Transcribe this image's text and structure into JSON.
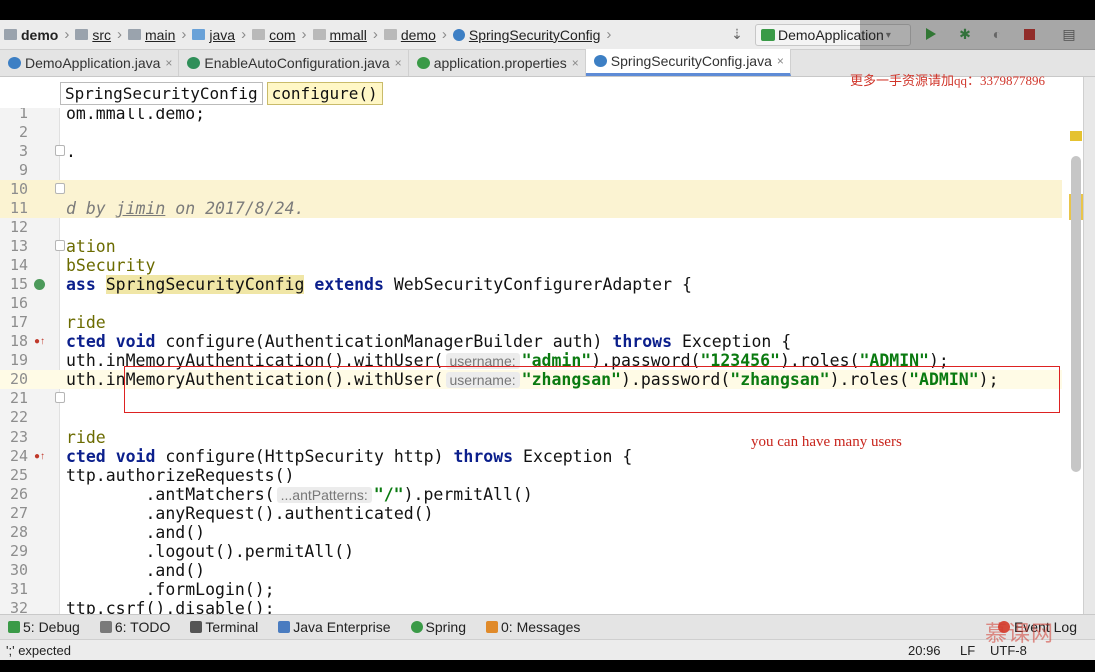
{
  "breadcrumb": [
    {
      "label": "demo",
      "icon": "project-folder-icon"
    },
    {
      "label": "src",
      "icon": "folder-icon"
    },
    {
      "label": "main",
      "icon": "folder-icon"
    },
    {
      "label": "java",
      "icon": "source-folder-icon"
    },
    {
      "label": "com",
      "icon": "package-icon"
    },
    {
      "label": "mmall",
      "icon": "package-icon"
    },
    {
      "label": "demo",
      "icon": "package-icon"
    },
    {
      "label": "SpringSecurityConfig",
      "icon": "class-icon"
    }
  ],
  "run_config": {
    "label": "DemoApplication"
  },
  "tabs": [
    {
      "label": "DemoApplication.java",
      "icon_color": "#3d7fc4",
      "active": false
    },
    {
      "label": "EnableAutoConfiguration.java",
      "icon_color": "#2f8f59",
      "active": false
    },
    {
      "label": "application.properties",
      "icon_color": "#3a9a47",
      "active": false
    },
    {
      "label": "SpringSecurityConfig.java",
      "icon_color": "#3d7fc4",
      "active": true
    }
  ],
  "method_path": {
    "class_name": "SpringSecurityConfig",
    "method_name": "configure()"
  },
  "editor": {
    "lines": [
      {
        "n": "1",
        "text": "om.mmall.demo;"
      },
      {
        "n": "2",
        "text": ""
      },
      {
        "n": "3",
        "text": "."
      },
      {
        "n": "9",
        "text": ""
      },
      {
        "n": "10",
        "text": ""
      },
      {
        "n": "11",
        "text": "d by jimin on 2017/8/24."
      },
      {
        "n": "12",
        "text": ""
      },
      {
        "n": "13",
        "text": "ation"
      },
      {
        "n": "14",
        "text": "bSecurity"
      },
      {
        "n": "15",
        "text": "ass SpringSecurityConfig extends WebSecurityConfigurerAdapter {"
      },
      {
        "n": "16",
        "text": ""
      },
      {
        "n": "17",
        "text": "ride"
      },
      {
        "n": "18",
        "text": "cted void configure(AuthenticationManagerBuilder auth) throws Exception {"
      },
      {
        "n": "19",
        "text": "uth.inMemoryAuthentication().withUser( username: \"admin\").password(\"123456\").roles(\"ADMIN\");"
      },
      {
        "n": "20",
        "text": "uth.inMemoryAuthentication().withUser( username: \"zhangsan\").password(\"zhangsan\").roles(\"ADMIN\");"
      },
      {
        "n": "21",
        "text": ""
      },
      {
        "n": "22",
        "text": ""
      },
      {
        "n": "23",
        "text": "ride"
      },
      {
        "n": "24",
        "text": "cted void configure(HttpSecurity http) throws Exception {"
      },
      {
        "n": "25",
        "text": "ttp.authorizeRequests()"
      },
      {
        "n": "26",
        "text": "        .antMatchers( ...antPatterns: \"/\").permitAll()"
      },
      {
        "n": "27",
        "text": "        .anyRequest().authenticated()"
      },
      {
        "n": "28",
        "text": "        .and()"
      },
      {
        "n": "29",
        "text": "        .logout().permitAll()"
      },
      {
        "n": "30",
        "text": "        .and()"
      },
      {
        "n": "31",
        "text": "        .formLogin();"
      },
      {
        "n": "32",
        "text": "ttp.csrf().disable();"
      }
    ],
    "tokens": {
      "l1": "om.mmall.demo;",
      "l3": ".",
      "l11a": "d by ",
      "l11b": "jimin",
      "l11c": " on ",
      "l11d": "2017/8/24.",
      "l13": "ation",
      "l14": "bSecurity",
      "l15a": "ass",
      "l15b": "SpringSecurityConfig",
      "l15c": "extends",
      "l15d": "WebSecurityConfigurerAdapter {",
      "l17": "ride",
      "l18a": "cted",
      "l18b": "void",
      "l18c": "configure(AuthenticationManagerBuilder auth)",
      "l18d": "throws",
      "l18e": "Exception {",
      "l19a": "uth.inMemoryAuthentication().withUser(",
      "l19hint": "username:",
      "l19b": "\"admin\"",
      "l19c": ").password(",
      "l19d": "\"123456\"",
      "l19e": ").roles(",
      "l19f": "\"ADMIN\"",
      "l19g": ");",
      "l20a": "uth.inMemoryAuthentication().withUser(",
      "l20hint": "username:",
      "l20b": "\"zhangsan\"",
      "l20c": ").password(",
      "l20d": "\"zhangsan\"",
      "l20e": ").roles(",
      "l20f": "\"ADMIN\"",
      "l20g": ");",
      "l23": "ride",
      "l24a": "cted",
      "l24b": "void",
      "l24c": "configure(HttpSecurity http)",
      "l24d": "throws",
      "l24e": "Exception {",
      "l25": "ttp.authorizeRequests()",
      "l26a": "        .antMatchers(",
      "l26hint": "...antPatterns:",
      "l26b": "\"/\"",
      "l26c": ").permitAll()",
      "l27": "        .anyRequest().authenticated()",
      "l28": "        .and()",
      "l29": "        .logout().permitAll()",
      "l30": "        .and()",
      "l31": "        .formLogin();",
      "l32": "ttp.csrf().disable();"
    }
  },
  "annotation_note": "you can have many users",
  "watermark_text": "更多一手资源请加qq：3379877896",
  "tool_windows": [
    {
      "label": "5: Debug",
      "icon_color": "#3a9a47"
    },
    {
      "label": "6: TODO",
      "icon_color": "#7a7a7a"
    },
    {
      "label": "Terminal",
      "icon_color": "#555555"
    },
    {
      "label": "Java Enterprise",
      "icon_color": "#4a7cc0"
    },
    {
      "label": "Spring",
      "icon_color": "#3a9a47"
    },
    {
      "label": "0: Messages",
      "icon_color": "#e08a2a"
    }
  ],
  "event_log": {
    "label": "Event Log"
  },
  "status": {
    "message": "';' expected",
    "position": "20:96",
    "line_sep": "LF",
    "encoding": "UTF-8"
  },
  "corner_logo": "慕课网"
}
